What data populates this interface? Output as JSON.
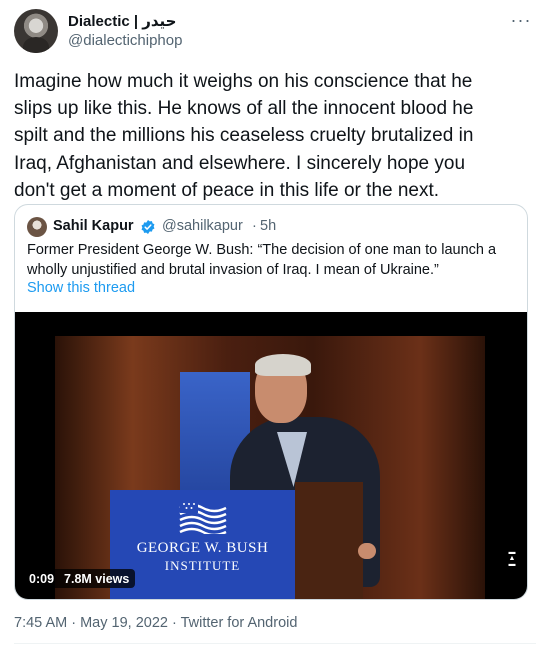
{
  "author": {
    "display_name": "Dialectic | حيدر",
    "handle": "@dialectichiphop"
  },
  "tweet": {
    "text": "Imagine how much it weighs on his conscience that he\nslips up like this. He knows of all the innocent blood he\nspilt and the millions his ceaseless cruelty brutalized in\nIraq, Afghanistan and elsewhere. I sincerely hope you\ndon't get a moment of peace in this life or the next."
  },
  "quote": {
    "name": "Sahil Kapur",
    "handle": "@sahilkapur",
    "separator": "·",
    "time": "5h",
    "text": "Former President George W. Bush: “The decision of one man to launch a wholly unjustified and brutal invasion of Iraq. I mean of Ukraine.”",
    "show_thread": "Show this thread",
    "video": {
      "duration": "0:09",
      "views": "7.8M views",
      "podium_title": "GEORGE W. BUSH",
      "podium_subtitle": "INSTITUTE"
    }
  },
  "footer": {
    "timestamp": "7:45 AM · May 19, 2022 · Twitter for Android"
  },
  "colors": {
    "link": "#1d9bf0",
    "secondary_text": "#536471",
    "border": "#cfd9de"
  },
  "icons": {
    "more": "more-icon",
    "verified": "verified-badge-icon"
  }
}
